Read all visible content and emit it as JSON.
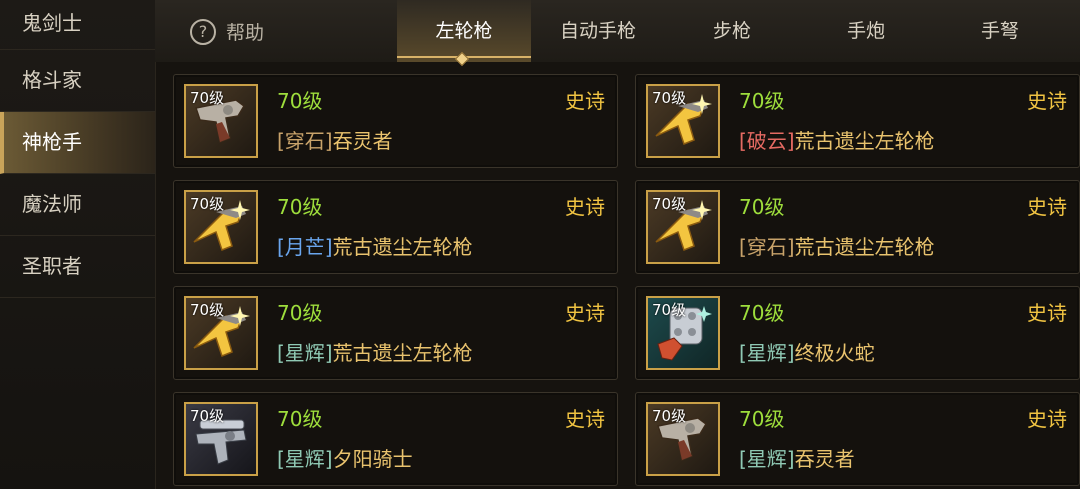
{
  "sidebar": {
    "items": [
      {
        "label": "鬼剑士"
      },
      {
        "label": "格斗家"
      },
      {
        "label": "神枪手"
      },
      {
        "label": "魔法师"
      },
      {
        "label": "圣职者"
      }
    ],
    "active_index": 2
  },
  "header": {
    "help_label": "帮助",
    "tabs": [
      {
        "label": "左轮枪"
      },
      {
        "label": "自动手枪"
      },
      {
        "label": "步枪"
      },
      {
        "label": "手炮"
      },
      {
        "label": "手弩"
      }
    ],
    "active_tab": 0
  },
  "items": [
    {
      "thumb_level": "70级",
      "level": "70级",
      "rarity": "史诗",
      "tag": "[穿石]",
      "tag_color": "#c8a36a",
      "name": "吞灵者",
      "icon": "revolver-silver-icon"
    },
    {
      "thumb_level": "70级",
      "level": "70级",
      "rarity": "史诗",
      "tag": "[破云]",
      "tag_color": "#e56a62",
      "name": "荒古遗尘左轮枪",
      "icon": "revolver-gold-icon"
    },
    {
      "thumb_level": "70级",
      "level": "70级",
      "rarity": "史诗",
      "tag": "[月芒]",
      "tag_color": "#6aa6ee",
      "name": "荒古遗尘左轮枪",
      "icon": "revolver-gold-icon"
    },
    {
      "thumb_level": "70级",
      "level": "70级",
      "rarity": "史诗",
      "tag": "[穿石]",
      "tag_color": "#c8a36a",
      "name": "荒古遗尘左轮枪",
      "icon": "revolver-gold-icon"
    },
    {
      "thumb_level": "70级",
      "level": "70级",
      "rarity": "史诗",
      "tag": "[星辉]",
      "tag_color": "#8fc9b4",
      "name": "荒古遗尘左轮枪",
      "icon": "revolver-gold-icon"
    },
    {
      "thumb_level": "70级",
      "level": "70级",
      "rarity": "史诗",
      "tag": "[星辉]",
      "tag_color": "#8fc9b4",
      "name": "终极火蛇",
      "icon": "revolver-cylinder-icon"
    },
    {
      "thumb_level": "70级",
      "level": "70级",
      "rarity": "史诗",
      "tag": "[星辉]",
      "tag_color": "#8fc9b4",
      "name": "夕阳骑士",
      "icon": "revolver-scope-icon"
    },
    {
      "thumb_level": "70级",
      "level": "70级",
      "rarity": "史诗",
      "tag": "[星辉]",
      "tag_color": "#8fc9b4",
      "name": "吞灵者",
      "icon": "revolver-silver-icon"
    }
  ],
  "colors": {
    "level": "#9ede3c",
    "rarity": "#f1c442",
    "name": "#e9c36e",
    "accent": "#c9a047"
  }
}
